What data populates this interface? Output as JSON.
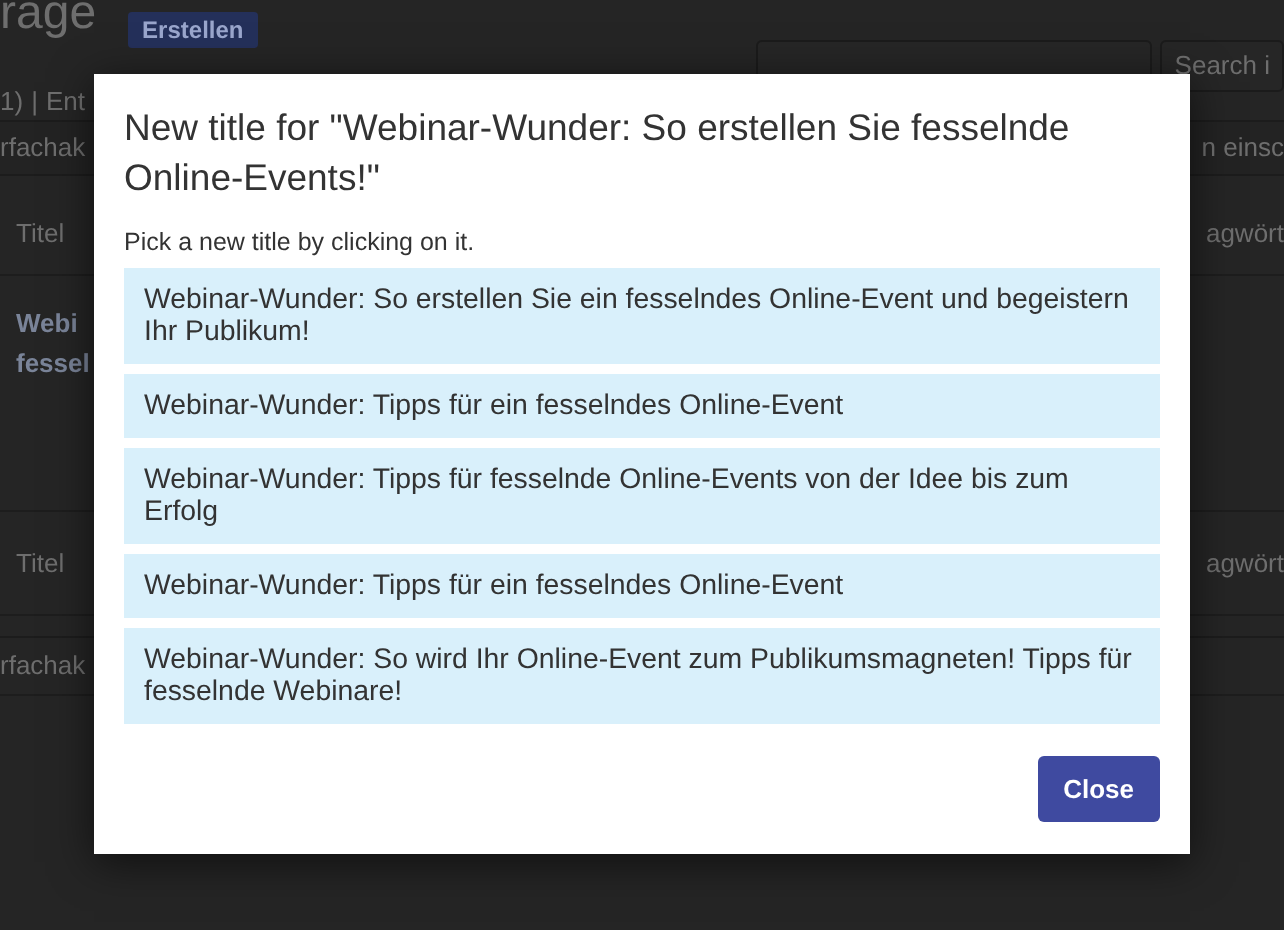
{
  "background": {
    "heading": "rage",
    "create_button": "Erstellen",
    "view_links": [
      "1)",
      "|",
      "Ent"
    ],
    "search_button": "Search i",
    "filter_left": "rfachak",
    "filter_right": "n einsc",
    "table": {
      "header": [
        "Titel",
        "agwört"
      ],
      "row_title": [
        "Webi",
        "fessel"
      ],
      "footer": [
        "Titel",
        "agwört"
      ]
    },
    "bottom_filter": "rfachak"
  },
  "modal": {
    "title": "New title for \"Webinar-Wunder: So erstellen Sie fesselnde Online-Events!\"",
    "instruction": "Pick a new title by clicking on it.",
    "options": [
      "Webinar-Wunder: So erstellen Sie ein fesselndes Online-Event und begeistern Ihr Publikum!",
      "Webinar-Wunder: Tipps für ein fesselndes Online-Event",
      "Webinar-Wunder: Tipps für fesselnde Online-Events von der Idee bis zum Erfolg",
      "Webinar-Wunder: Tipps für ein fesselndes Online-Event",
      "Webinar-Wunder: So wird Ihr Online-Event zum Publikumsmagneten! Tipps für fesselnde Webinare!"
    ],
    "close_button": "Close"
  }
}
